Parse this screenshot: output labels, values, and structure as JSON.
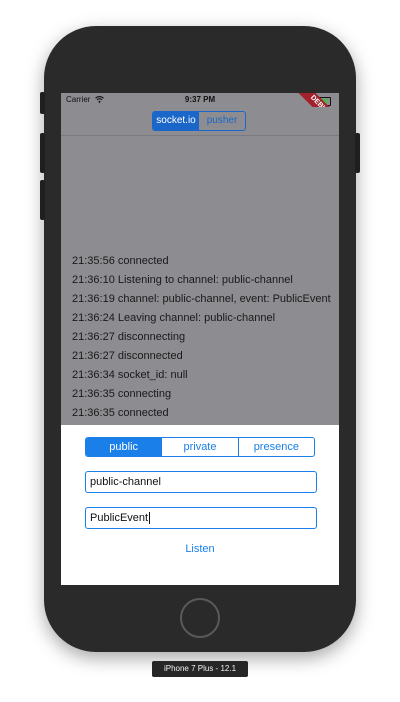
{
  "status_bar": {
    "carrier": "Carrier",
    "time": "9:37 PM",
    "debug": "DEBUG",
    "battery_level": 0.9
  },
  "nav": {
    "segments": [
      {
        "label": "socket.io",
        "active": true
      },
      {
        "label": "pusher",
        "active": false
      }
    ]
  },
  "log": [
    "21:35:56 connected",
    "21:36:10 Listening to channel: public-channel",
    "21:36:19 channel: public-channel, event: PublicEvent",
    "21:36:24 Leaving channel: public-channel",
    "21:36:27 disconnecting",
    "21:36:27 disconnected",
    "21:36:34 socket_id: null",
    "21:36:35 connecting",
    "21:36:35 connected"
  ],
  "panel": {
    "tabs": [
      {
        "label": "public",
        "active": true
      },
      {
        "label": "private",
        "active": false
      },
      {
        "label": "presence",
        "active": false
      }
    ],
    "channel_value": "public-channel",
    "event_value": "PublicEvent",
    "listen_label": "Listen"
  },
  "device_label": "iPhone 7 Plus - 12.1",
  "colors": {
    "accent": "#1a7fe8",
    "nav_accent": "#1a66c9",
    "overlay": "#8c8c91",
    "debug": "#a3212c"
  }
}
